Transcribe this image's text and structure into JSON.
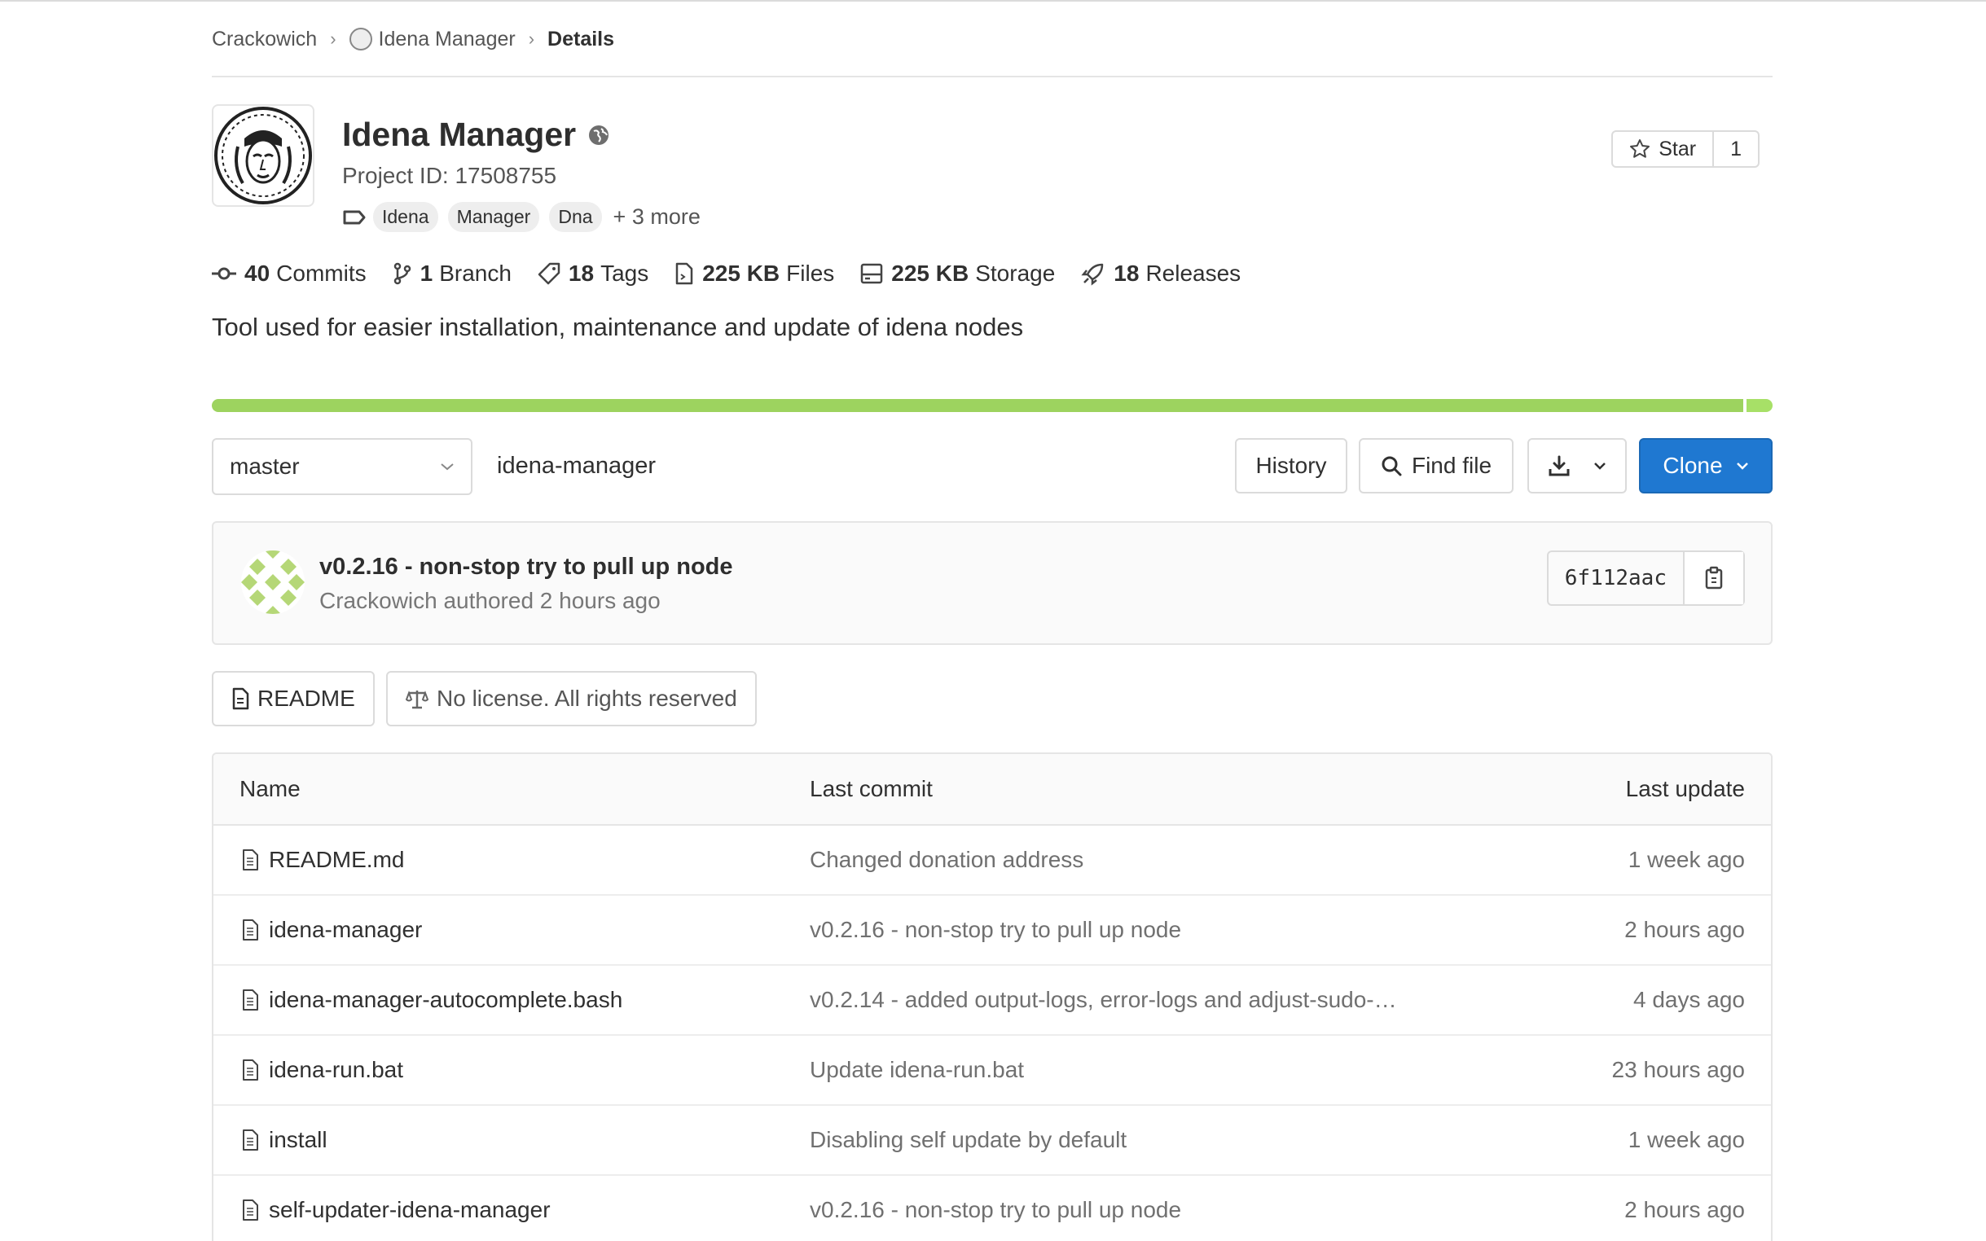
{
  "breadcrumb": {
    "items": [
      "Crackowich",
      "Idena Manager",
      "Details"
    ]
  },
  "project": {
    "title": "Idena Manager",
    "id_text": "Project ID: 17508755",
    "topics": [
      "Idena",
      "Manager",
      "Dna"
    ],
    "more_topics": "+ 3 more",
    "star_label": "Star",
    "star_count": "1",
    "description": "Tool used for easier installation, maintenance and update of idena nodes"
  },
  "stats": [
    {
      "num": "40",
      "label": "Commits",
      "icon": "commit-icon"
    },
    {
      "num": "1",
      "label": "Branch",
      "icon": "branch-icon"
    },
    {
      "num": "18",
      "label": "Tags",
      "icon": "tag-icon"
    },
    {
      "num": "225 KB",
      "label": "Files",
      "icon": "file-icon"
    },
    {
      "num": "225 KB",
      "label": "Storage",
      "icon": "storage-icon"
    },
    {
      "num": "18",
      "label": "Releases",
      "icon": "rocket-icon"
    }
  ],
  "colors": {
    "accent": "#1f78d1",
    "language_bar_primary": "#9dd35f",
    "language_bar_secondary": "#a7e067"
  },
  "toolbar": {
    "branch": "master",
    "path": "idena-manager",
    "history": "History",
    "find_file": "Find file",
    "clone": "Clone"
  },
  "last_commit": {
    "title": "v0.2.16 - non-stop try to pull up node",
    "meta": "Crackowich authored 2 hours ago",
    "sha": "6f112aac"
  },
  "project_buttons": {
    "readme": "README",
    "license": "No license. All rights reserved"
  },
  "file_table": {
    "headers": {
      "name": "Name",
      "commit": "Last commit",
      "update": "Last update"
    },
    "rows": [
      {
        "name": "README.md",
        "commit": "Changed donation address",
        "update": "1 week ago"
      },
      {
        "name": "idena-manager",
        "commit": "v0.2.16 - non-stop try to pull up node",
        "update": "2 hours ago"
      },
      {
        "name": "idena-manager-autocomplete.bash",
        "commit": "v0.2.14 - added output-logs, error-logs and adjust-sudo-…",
        "update": "4 days ago"
      },
      {
        "name": "idena-run.bat",
        "commit": "Update idena-run.bat",
        "update": "23 hours ago"
      },
      {
        "name": "install",
        "commit": "Disabling self update by default",
        "update": "1 week ago"
      },
      {
        "name": "self-updater-idena-manager",
        "commit": "v0.2.16 - non-stop try to pull up node",
        "update": "2 hours ago"
      }
    ]
  }
}
